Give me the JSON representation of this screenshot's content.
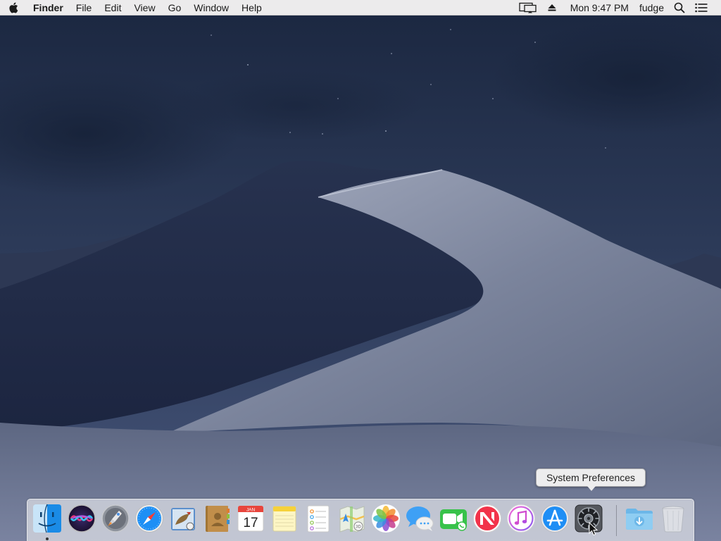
{
  "menubar": {
    "app_name": "Finder",
    "menus": [
      "File",
      "Edit",
      "View",
      "Go",
      "Window",
      "Help"
    ],
    "clock": "Mon 9:47 PM",
    "user": "fudge",
    "icons": [
      "apple-icon",
      "display-mirroring-icon",
      "eject-icon",
      "spotlight-search-icon",
      "notification-center-icon"
    ]
  },
  "tooltip": {
    "text": "System Preferences"
  },
  "dock": {
    "items": [
      {
        "name": "Finder",
        "icon": "finder-icon",
        "running": true
      },
      {
        "name": "Siri",
        "icon": "siri-icon"
      },
      {
        "name": "Launchpad",
        "icon": "launchpad-icon"
      },
      {
        "name": "Safari",
        "icon": "safari-icon"
      },
      {
        "name": "Mail",
        "icon": "mail-icon"
      },
      {
        "name": "Contacts",
        "icon": "contacts-icon"
      },
      {
        "name": "Calendar",
        "icon": "calendar-icon",
        "month": "JAN",
        "day": "17"
      },
      {
        "name": "Notes",
        "icon": "notes-icon"
      },
      {
        "name": "Reminders",
        "icon": "reminders-icon"
      },
      {
        "name": "Maps",
        "icon": "maps-icon"
      },
      {
        "name": "Photos",
        "icon": "photos-icon"
      },
      {
        "name": "Messages",
        "icon": "messages-icon"
      },
      {
        "name": "FaceTime",
        "icon": "facetime-icon"
      },
      {
        "name": "News",
        "icon": "news-icon"
      },
      {
        "name": "iTunes",
        "icon": "itunes-icon"
      },
      {
        "name": "App Store",
        "icon": "app-store-icon"
      },
      {
        "name": "System Preferences",
        "icon": "system-preferences-icon"
      },
      {
        "name": "Downloads",
        "icon": "downloads-folder-icon"
      },
      {
        "name": "Trash",
        "icon": "trash-icon"
      }
    ]
  },
  "colors": {
    "menubar_bg": "#ecebec",
    "sky_top": "#1d2a44",
    "sky_bottom": "#3a4866",
    "dune_light": "#8e96ac",
    "dune_shadow": "#222c48"
  }
}
